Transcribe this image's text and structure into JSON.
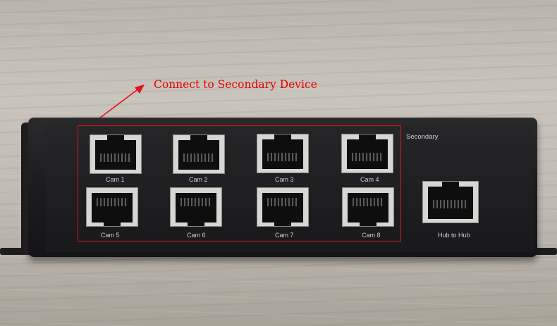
{
  "annotation": {
    "text": "Connect to Secondary Device",
    "color": "#e60000"
  },
  "device": {
    "section_label": "Secondary",
    "ports": [
      {
        "label": "Cam 1"
      },
      {
        "label": "Cam 2"
      },
      {
        "label": "Cam 3"
      },
      {
        "label": "Cam 4"
      },
      {
        "label": "Cam 5"
      },
      {
        "label": "Cam 6"
      },
      {
        "label": "Cam 7"
      },
      {
        "label": "Cam 8"
      }
    ],
    "hub_port": {
      "label": "Hub to Hub"
    }
  },
  "colors": {
    "highlight": "#e0141a",
    "device_body": "#1e1e20",
    "port_frame": "#d6d6d2"
  }
}
